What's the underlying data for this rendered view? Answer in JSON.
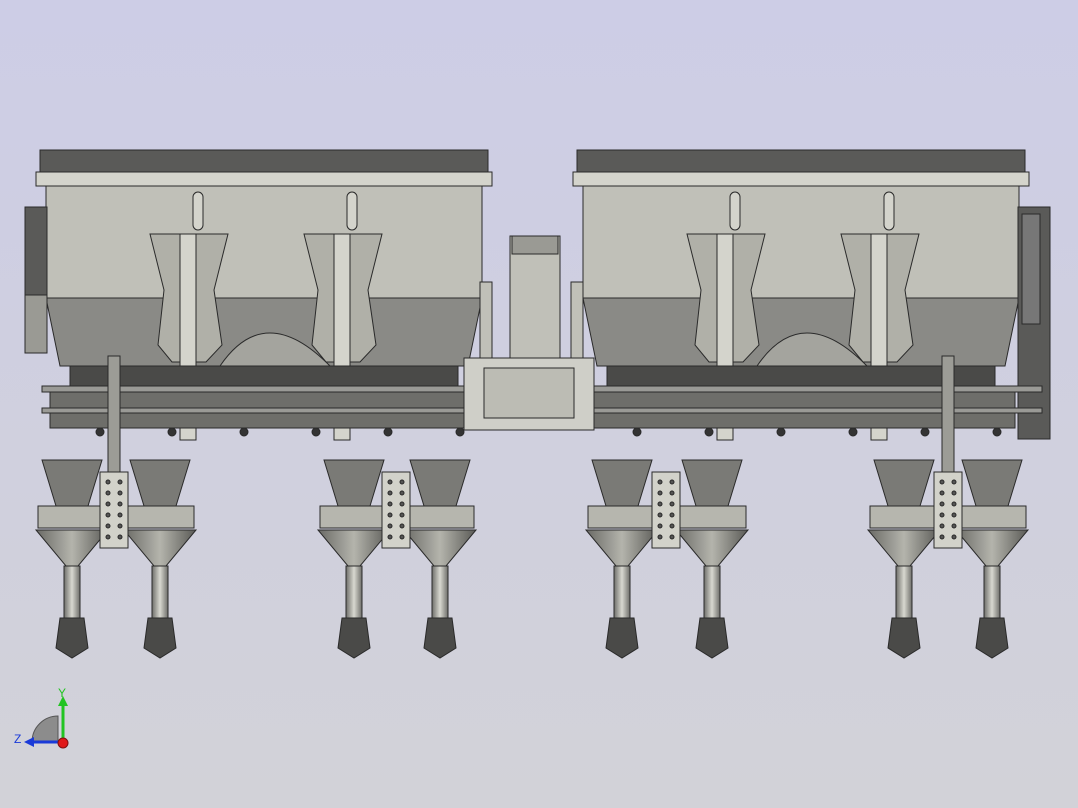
{
  "viewport": {
    "background_top": "#cdcde6",
    "background_bottom": "#d2d2d8"
  },
  "model": {
    "body_color": "#c0c0b8",
    "dark_color": "#5a5a58",
    "mid_color": "#8a8a86",
    "line_color": "#2a2a2a",
    "light_color": "#d4d4cc"
  },
  "triad": {
    "y_label": "Y",
    "z_label": "Z",
    "y_color": "#22c422",
    "z_color": "#1a3ad8",
    "x_color": "#e01818"
  }
}
